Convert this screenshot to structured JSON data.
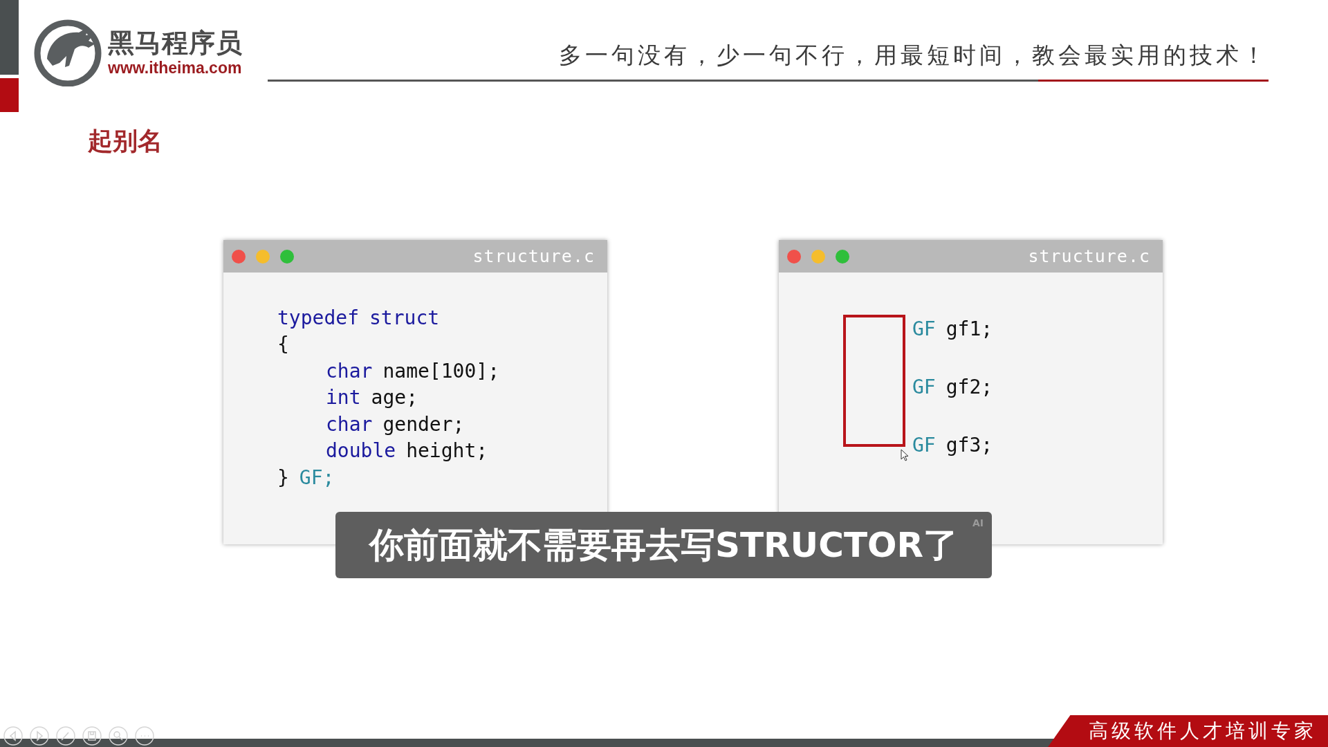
{
  "header": {
    "brand_name": "黑马程序员",
    "brand_url": "www.itheima.com",
    "tagline": "多一句没有，少一句不行，用最短时间，教会最实用的技术！"
  },
  "slide_title": "起别名",
  "windows": [
    {
      "title": "structure.c",
      "kind": "code",
      "lines": [
        {
          "tokens": [
            {
              "text": "typedef",
              "kind": "keyword"
            },
            {
              "text": "struct",
              "kind": "keyword"
            }
          ]
        },
        {
          "tokens": [
            {
              "text": "{",
              "kind": "plain"
            }
          ],
          "children": [
            {
              "tokens": [
                {
                  "text": "char",
                  "kind": "keyword"
                },
                {
                  "text": "name[100];",
                  "kind": "plain"
                }
              ]
            },
            {
              "tokens": [
                {
                  "text": "int",
                  "kind": "keyword"
                },
                {
                  "text": "age;",
                  "kind": "plain"
                }
              ]
            },
            {
              "tokens": [
                {
                  "text": "char",
                  "kind": "keyword"
                },
                {
                  "text": "gender;",
                  "kind": "plain"
                }
              ]
            },
            {
              "tokens": [
                {
                  "text": "double",
                  "kind": "keyword"
                },
                {
                  "text": "height;",
                  "kind": "plain"
                }
              ]
            }
          ]
        },
        {
          "tokens": [
            {
              "text": "}",
              "kind": "plain"
            },
            {
              "text": "GF;",
              "kind": "type"
            }
          ]
        }
      ]
    },
    {
      "title": "structure.c",
      "kind": "declarations",
      "highlighted": true,
      "lines": [
        {
          "tokens": [
            {
              "text": "GF",
              "kind": "type"
            },
            {
              "text": "gf1;",
              "kind": "plain"
            }
          ]
        },
        {
          "tokens": [
            {
              "text": "GF",
              "kind": "type"
            },
            {
              "text": "gf2;",
              "kind": "plain"
            }
          ]
        },
        {
          "tokens": [
            {
              "text": "GF",
              "kind": "type"
            },
            {
              "text": "gf3;",
              "kind": "plain"
            }
          ]
        }
      ]
    }
  ],
  "subtitle": {
    "text": "你前面就不需要再去写STRUCTOR了",
    "badge": "AI"
  },
  "footer_tag": "高级软件人才培训专家"
}
